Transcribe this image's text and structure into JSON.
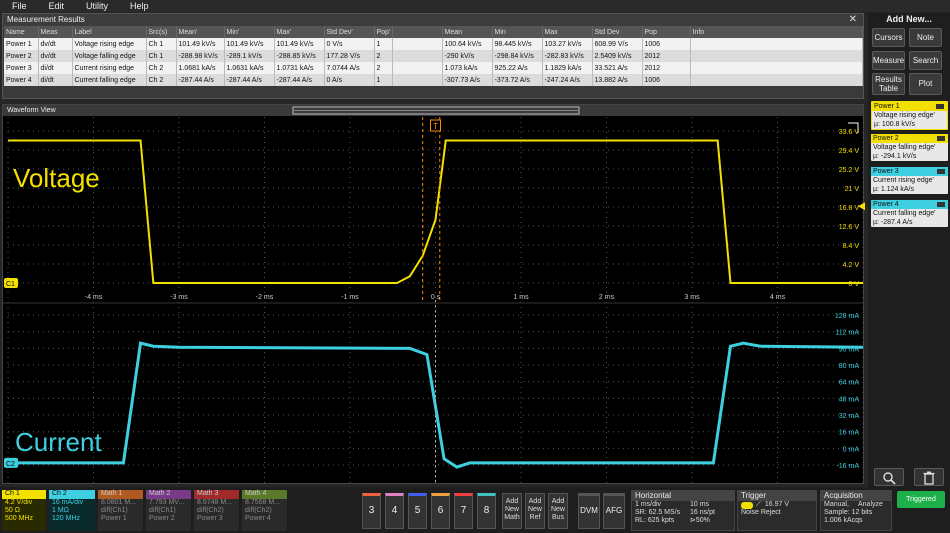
{
  "menu": [
    "File",
    "Edit",
    "Utility",
    "Help"
  ],
  "measurements": {
    "title": "Measurement Results",
    "columns": [
      "Name",
      "Meas",
      "Label",
      "Src(s)",
      "Mean'",
      "Min'",
      "Max'",
      "Std Dev'",
      "Pop'",
      "",
      "Mean",
      "Min",
      "Max",
      "Std Dev",
      "Pop",
      "Info"
    ],
    "rows": [
      [
        "Power 1",
        "dv/dt",
        "Voltage rising edge",
        "Ch 1",
        "101.49 kV/s",
        "101.49 kV/s",
        "101.49 kV/s",
        "0 V/s",
        "1",
        "",
        "100.64 kV/s",
        "98.445 kV/s",
        "103.27 kV/s",
        "608.99 V/s",
        "1006",
        ""
      ],
      [
        "Power 2",
        "dv/dt",
        "Voltage falling edge",
        "Ch 1",
        "-288.98 kV/s",
        "-289.1 kV/s",
        "-288.85 kV/s",
        "177.28 V/s",
        "2",
        "",
        "-290 kV/s",
        "-298.84 kV/s",
        "-282.83 kV/s",
        "2.5409 kV/s",
        "2012",
        ""
      ],
      [
        "Power 3",
        "di/dt",
        "Current rising edge",
        "Ch 2",
        "1.0681 kA/s",
        "1.0631 kA/s",
        "1.0731 kA/s",
        "7.0744 A/s",
        "2",
        "",
        "1.073 kA/s",
        "925.22 A/s",
        "1.1829 kA/s",
        "33.521 A/s",
        "2012",
        ""
      ],
      [
        "Power 4",
        "di/dt",
        "Current falling edge",
        "Ch 2",
        "-287.44 A/s",
        "-287.44 A/s",
        "-287.44 A/s",
        "0 A/s",
        "1",
        "",
        "-307.73 A/s",
        "-373.72 A/s",
        "-247.24 A/s",
        "13.882 A/s",
        "1006",
        ""
      ]
    ]
  },
  "side": {
    "title": "Add New...",
    "buttons": [
      "Cursors",
      "Note",
      "Measure",
      "Search",
      "Results Table",
      "Plot"
    ],
    "power": [
      {
        "name": "Power 1",
        "label": "Voltage rising edge'",
        "value": "µ:   100.8 kV/s",
        "color": "#f2e000"
      },
      {
        "name": "Power 2",
        "label": "Voltage falling edge'",
        "value": "µ:   -294.1 kV/s",
        "color": "#f2e000"
      },
      {
        "name": "Power 3",
        "label": "Current rising edge'",
        "value": "µ:   1.124 kA/s",
        "color": "#3ed0e0"
      },
      {
        "name": "Power 4",
        "label": "Current falling edge'",
        "value": "µ:   -287.4 A/s",
        "color": "#3ed0e0"
      }
    ]
  },
  "waveform": {
    "title": "Waveform View",
    "voltage_label": "Voltage",
    "current_label": "Current",
    "ch1_marker": "C1",
    "ch2_marker": "C2",
    "time_ticks": [
      "-4 ms",
      "-3 ms",
      "-2 ms",
      "-1 ms",
      "0 s",
      "1 ms",
      "2 ms",
      "3 ms",
      "4 ms"
    ],
    "v_ticks": [
      "33.6 V",
      "29.4 V",
      "25.2 V",
      "21 V",
      "16.8 V",
      "12.6 V",
      "8.4 V",
      "4.2 V",
      "0 V"
    ],
    "i_ticks": [
      "128 mA",
      "112 mA",
      "96 mA",
      "80 mA",
      "64 mA",
      "48 mA",
      "32 mA",
      "16 mA",
      "0 mA",
      "-16 mA"
    ],
    "trigger_marker": "T",
    "colors": {
      "ch1": "#f2e000",
      "ch2": "#3ed0e0",
      "cursor": "#ff8a00"
    }
  },
  "bottom": {
    "ch1": {
      "name": "Ch 1",
      "l1": "4.2 V/div",
      "l2": "50 Ω",
      "l3": "500 MHz"
    },
    "ch2": {
      "name": "Ch 2",
      "l1": "16 mA/div",
      "l2": "1 MΩ",
      "l3": "120 MHz"
    },
    "math": [
      {
        "name": "Math 1",
        "l1": "8.0801 M...",
        "l2": "diff(Ch1)",
        "l3": "Power 1",
        "color": "#b05a20"
      },
      {
        "name": "Math 2",
        "l1": "7.793 MV...",
        "l2": "diff(Ch1)",
        "l3": "Power 2",
        "color": "#7a3a8a"
      },
      {
        "name": "Math 3",
        "l1": "8.6748 M...",
        "l2": "diff(Ch2)",
        "l3": "Power 3",
        "color": "#a02a2a"
      },
      {
        "name": "Math 4",
        "l1": "8.7568 M...",
        "l2": "diff(Ch2)",
        "l3": "Power 4",
        "color": "#5a7a2a"
      }
    ],
    "numbers": [
      "3",
      "4",
      "5",
      "6",
      "7",
      "8"
    ],
    "number_colors": [
      "#f06040",
      "#e080c0",
      "#4060f0",
      "#f0a040",
      "#f04040",
      "#40c0c0"
    ],
    "add": [
      "Add New Math",
      "Add New Ref",
      "Add New Bus"
    ],
    "dvm": "DVM",
    "afg": "AFG",
    "horizontal": {
      "title": "Horizontal",
      "a1": "1 ms/div",
      "a2": "10 ms",
      "b1": "SR: 62.5 MS/s",
      "b2": "16 ns/pt",
      "c1": "RL: 625 kpts",
      "c2": "50%"
    },
    "trigger": {
      "title": "Trigger",
      "level": "16.97 V",
      "mode": "Noise Reject"
    },
    "acquisition": {
      "title": "Acquisition",
      "a1": "Manual,",
      "a2": "Analyze",
      "b1": "Sample: 12 bits",
      "c1": "1.006 kAcqs"
    },
    "status": "Triggered"
  }
}
